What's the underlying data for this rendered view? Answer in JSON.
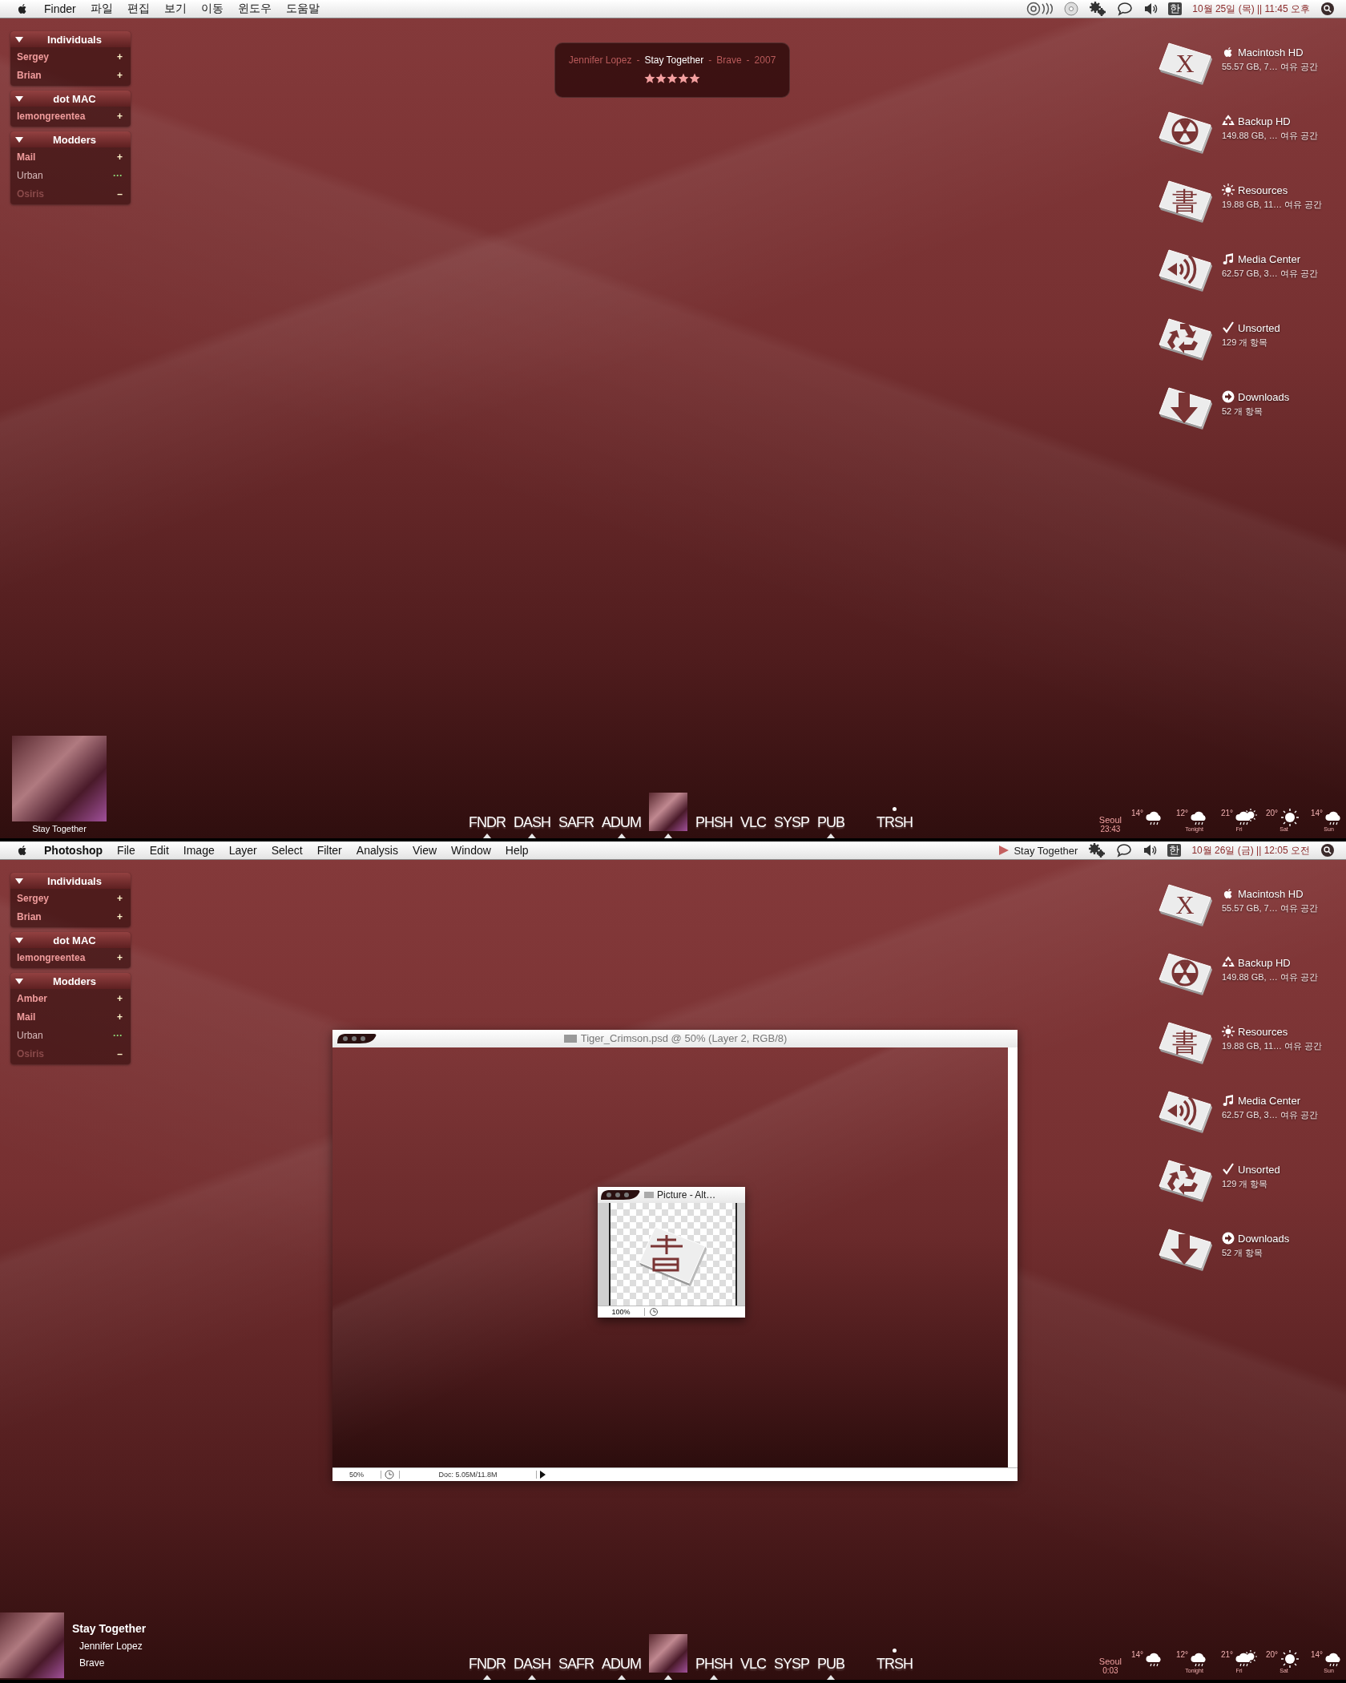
{
  "screens": [
    {
      "menu_bar": {
        "app_name": {
          "text": "Finder",
          "bold": false
        },
        "menus": [
          "파일",
          "편집",
          "보기",
          "이동",
          "윈도우",
          "도움말"
        ],
        "status_items": [
          {
            "kind": "audio-cd"
          },
          {
            "kind": "disc"
          },
          {
            "kind": "gears"
          },
          {
            "kind": "chat"
          },
          {
            "kind": "volume"
          },
          {
            "kind": "input",
            "text": "한"
          },
          {
            "kind": "clock",
            "text": "10월 25일 (목) || 11:45 오후"
          },
          {
            "kind": "spotlight"
          }
        ]
      },
      "buddy_list": [
        {
          "name": "Individuals",
          "expanded": true,
          "buddies": [
            {
              "name": "Sergey",
              "kind": "available",
              "mark": "+"
            },
            {
              "name": "Brian",
              "kind": "available",
              "mark": "+"
            }
          ]
        },
        {
          "name": "dot MAC",
          "expanded": true,
          "buddies": [
            {
              "name": "lemongreentea",
              "kind": "available",
              "mark": "+"
            }
          ]
        },
        {
          "name": "Modders",
          "expanded": true,
          "buddies": [
            {
              "name": "Mail",
              "kind": "available",
              "mark": "+"
            },
            {
              "name": "Urban",
              "kind": "idle",
              "mark": "···"
            },
            {
              "name": "Osiris",
              "kind": "away",
              "mark": "–"
            }
          ]
        }
      ],
      "now_playing": {
        "segments": [
          {
            "text": "Jennifer Lopez",
            "highlight": false
          },
          {
            "text": "-",
            "highlight": false
          },
          {
            "text": "Stay Together",
            "highlight": true
          },
          {
            "text": "-",
            "highlight": false
          },
          {
            "text": "Brave",
            "highlight": false
          },
          {
            "text": "-",
            "highlight": false
          },
          {
            "text": "2007",
            "highlight": false
          }
        ],
        "stars": 5
      },
      "drives": [
        {
          "name": "Macintosh HD",
          "detail": "55.57 GB, 7… 여유 공간",
          "badge": {
            "kind": "apple"
          },
          "kind": "letter",
          "glyph": "X"
        },
        {
          "name": "Backup HD",
          "detail": "149.88 GB, … 여유 공간",
          "badge": {
            "kind": "recycle"
          },
          "kind": "radiation"
        },
        {
          "name": "Resources",
          "detail": "19.88 GB, 11… 여유 공간",
          "badge": {
            "kind": "sun"
          },
          "kind": "letter",
          "glyph": "書"
        },
        {
          "name": "Media Center",
          "detail": "62.57 GB, 3… 여유 공간",
          "badge": {
            "kind": "note"
          },
          "kind": "speaker"
        },
        {
          "name": "Unsorted",
          "detail": "129 개 항목",
          "badge": {
            "kind": "check"
          },
          "kind": "recycle"
        },
        {
          "name": "Downloads",
          "detail": "52 개 항목",
          "badge": {
            "kind": "arrow"
          },
          "kind": "down-arrow"
        }
      ],
      "album_widget": {
        "kind": "cover",
        "caption": "Stay Together"
      },
      "dock": [
        {
          "kind": "app",
          "label": "FNDR",
          "running": true,
          "dot": false
        },
        {
          "kind": "app",
          "label": "DASH",
          "running": true,
          "dot": false
        },
        {
          "kind": "app",
          "label": "SAFR",
          "running": false,
          "dot": false
        },
        {
          "kind": "app",
          "label": "ADUM",
          "running": true,
          "dot": false
        },
        {
          "kind": "art",
          "running": true,
          "dot": false
        },
        {
          "kind": "app",
          "label": "PHSH",
          "running": false,
          "dot": false
        },
        {
          "kind": "app",
          "label": "VLC",
          "running": false,
          "dot": false
        },
        {
          "kind": "app",
          "label": "SYSP",
          "running": false,
          "dot": false
        },
        {
          "kind": "app",
          "label": "PUB",
          "running": true,
          "dot": false
        },
        {
          "kind": "app",
          "label": "TRSH",
          "running": false,
          "dot": true
        }
      ],
      "weather": {
        "city": "Seoul",
        "time": "23:43",
        "days": [
          {
            "temp": "14°",
            "kind": "rain"
          },
          {
            "temp": "12°",
            "label": "Tonight",
            "kind": "rain"
          },
          {
            "temp": "21°",
            "label": "Fri",
            "kind": "partly"
          },
          {
            "temp": "20°",
            "label": "Sat",
            "kind": "sunny"
          },
          {
            "temp": "14°",
            "label": "Sun",
            "kind": "rain"
          }
        ]
      }
    },
    {
      "menu_bar": {
        "app_name": {
          "text": "Photoshop",
          "bold": true
        },
        "menus": [
          "File",
          "Edit",
          "Image",
          "Layer",
          "Select",
          "Filter",
          "Analysis",
          "View",
          "Window",
          "Help"
        ],
        "status_items": [
          {
            "kind": "now-playing",
            "text": "Stay Together"
          },
          {
            "kind": "gears"
          },
          {
            "kind": "chat"
          },
          {
            "kind": "volume"
          },
          {
            "kind": "input",
            "text": "한"
          },
          {
            "kind": "clock",
            "text": "10월 26일 (금) || 12:05 오전"
          },
          {
            "kind": "spotlight"
          }
        ]
      },
      "buddy_list": [
        {
          "name": "Individuals",
          "expanded": true,
          "buddies": [
            {
              "name": "Sergey",
              "kind": "available",
              "mark": "+"
            },
            {
              "name": "Brian",
              "kind": "available",
              "mark": "+"
            }
          ]
        },
        {
          "name": "dot MAC",
          "expanded": true,
          "buddies": [
            {
              "name": "lemongreentea",
              "kind": "available",
              "mark": "+"
            }
          ]
        },
        {
          "name": "Modders",
          "expanded": true,
          "buddies": [
            {
              "name": "Amber",
              "kind": "available",
              "mark": "+"
            },
            {
              "name": "Mail",
              "kind": "available",
              "mark": "+"
            },
            {
              "name": "Urban",
              "kind": "idle",
              "mark": "···"
            },
            {
              "name": "Osiris",
              "kind": "away",
              "mark": "–"
            }
          ]
        }
      ],
      "drives": [
        {
          "name": "Macintosh HD",
          "detail": "55.57 GB, 7… 여유 공간",
          "badge": {
            "kind": "apple"
          },
          "kind": "letter",
          "glyph": "X"
        },
        {
          "name": "Backup HD",
          "detail": "149.88 GB, … 여유 공간",
          "badge": {
            "kind": "recycle"
          },
          "kind": "radiation"
        },
        {
          "name": "Resources",
          "detail": "19.88 GB, 11… 여유 공간",
          "badge": {
            "kind": "sun"
          },
          "kind": "letter",
          "glyph": "書"
        },
        {
          "name": "Media Center",
          "detail": "62.57 GB, 3… 여유 공간",
          "badge": {
            "kind": "note"
          },
          "kind": "speaker"
        },
        {
          "name": "Unsorted",
          "detail": "129 개 항목",
          "badge": {
            "kind": "check"
          },
          "kind": "recycle"
        },
        {
          "name": "Downloads",
          "detail": "52 개 항목",
          "badge": {
            "kind": "arrow"
          },
          "kind": "down-arrow"
        }
      ],
      "document_window": {
        "title": "Tiger_Crimson.psd @ 50% (Layer 2, RGB/8)",
        "zoom": "50%",
        "doc_info": "Doc: 5.05M/11.8M",
        "inner_window": {
          "title": "Picture - Alt…",
          "zoom": "100%"
        }
      },
      "album_widget": {
        "kind": "track",
        "title": "Stay Together",
        "artist": "Jennifer Lopez",
        "album": "Brave"
      },
      "dock": [
        {
          "kind": "app",
          "label": "FNDR",
          "running": true,
          "dot": false
        },
        {
          "kind": "app",
          "label": "DASH",
          "running": true,
          "dot": false
        },
        {
          "kind": "app",
          "label": "SAFR",
          "running": false,
          "dot": false
        },
        {
          "kind": "app",
          "label": "ADUM",
          "running": true,
          "dot": false
        },
        {
          "kind": "art",
          "running": true,
          "dot": false
        },
        {
          "kind": "app",
          "label": "PHSH",
          "running": true,
          "dot": false
        },
        {
          "kind": "app",
          "label": "VLC",
          "running": false,
          "dot": false
        },
        {
          "kind": "app",
          "label": "SYSP",
          "running": false,
          "dot": false
        },
        {
          "kind": "app",
          "label": "PUB",
          "running": true,
          "dot": false
        },
        {
          "kind": "app",
          "label": "TRSH",
          "running": false,
          "dot": true
        }
      ],
      "weather": {
        "city": "Seoul",
        "time": "0:03",
        "days": [
          {
            "temp": "14°",
            "kind": "rain"
          },
          {
            "temp": "12°",
            "label": "Tonight",
            "kind": "rain"
          },
          {
            "temp": "21°",
            "label": "Fri",
            "kind": "partly"
          },
          {
            "temp": "20°",
            "label": "Sat",
            "kind": "sunny"
          },
          {
            "temp": "14°",
            "label": "Sun",
            "kind": "rain"
          }
        ]
      }
    }
  ]
}
